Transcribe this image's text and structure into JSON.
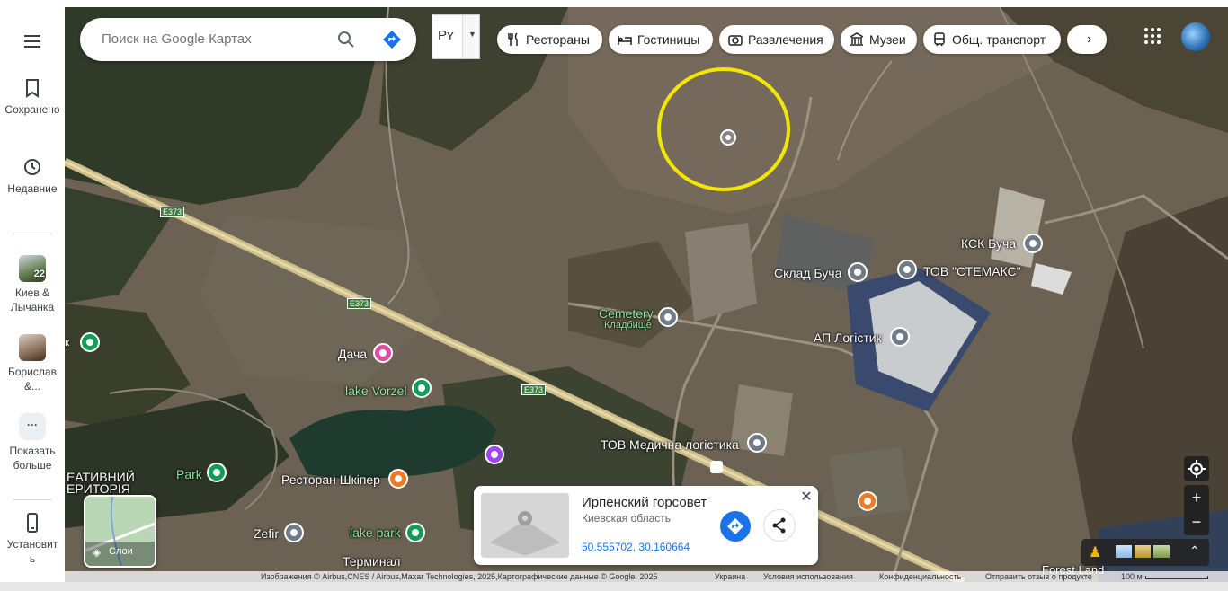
{
  "search": {
    "placeholder": "Поиск на Google Картах"
  },
  "language": {
    "label": "Рʏ"
  },
  "sidebar": {
    "items": [
      {
        "label": "Сохранено",
        "icon": "bookmark-icon"
      },
      {
        "label": "Недавние",
        "icon": "history-icon"
      },
      {
        "label": "Киев & Лычанка",
        "badge": "22"
      },
      {
        "label": "Борислав &..."
      },
      {
        "label": "Показать больше",
        "icon": "more-icon"
      },
      {
        "label": "Установить",
        "icon": "phone-icon"
      }
    ]
  },
  "chips": [
    {
      "label": "Рестораны",
      "icon": "restaurant-icon"
    },
    {
      "label": "Гостиницы",
      "icon": "hotel-icon"
    },
    {
      "label": "Развлечения",
      "icon": "camera-icon"
    },
    {
      "label": "Музеи",
      "icon": "museum-icon"
    },
    {
      "label": "Общ. транспорт",
      "icon": "transit-icon"
    }
  ],
  "places": {
    "ksk_bucha": "КСК Буча",
    "sklad": "Склад Буча",
    "stemaks": "ТОВ \"СТЕМАКС\"",
    "ap_logistik": "АП Логістик",
    "cemetery_en": "Cemetery",
    "cemetery_ru": "Кладбище",
    "dacha": "Дача",
    "lake_vorzel": "lake Vorzel",
    "park": "Park",
    "restoran": "Ресторан Шкіпер",
    "zefir": "Zefir",
    "lake_park": "lake park",
    "terminal": "Терминал",
    "tov_med": "ТОВ Медична логістика",
    "kreativniy_1": "ЕАТИВНИЙ",
    "kreativniy_2": "ЕРИТОРІЯ",
    "forest_land": "Forest Land",
    "left_k": "к"
  },
  "road": {
    "e373": "E373"
  },
  "card": {
    "title": "Ирпенский горсовет",
    "subtitle": "Киевская область",
    "coords": "50.555702, 30.160664"
  },
  "layers": {
    "label": "Слои"
  },
  "footer": {
    "imagery": "Изображения © Airbus,CNES / Airbus,Maxar Technologies, 2025,Картографические данные © Google, 2025",
    "country": "Украина",
    "terms": "Условия использования",
    "privacy": "Конфиденциальность",
    "feedback": "Отправить отзыв о продукте",
    "scale": "100 м"
  },
  "colors": {
    "accent": "#1a73e8",
    "highlight_circle": "#f5e600"
  }
}
